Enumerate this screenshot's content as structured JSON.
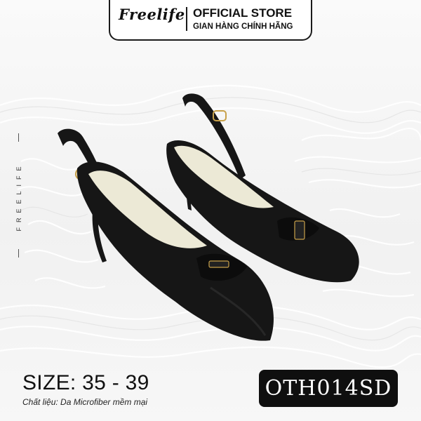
{
  "header": {
    "brand_logo": "Freelife",
    "store_title": "OFFICIAL STORE",
    "store_subtitle": "GIAN HÀNG CHÍNH HÃNG"
  },
  "side_brand": "FREELIFE",
  "product": {
    "size_label": "SIZE: 35 - 39",
    "material": "Chất liệu: Da Microfiber mềm mại",
    "code": "OTH014SD",
    "image": "pair-of-black-pointed-toe-slingback-heels-with-bow"
  },
  "colors": {
    "shoe": "#161616",
    "lining": "#ece9d6",
    "badge": "#0f0f0f",
    "background": "#f4f4f4",
    "hardware": "#c8a14a"
  }
}
